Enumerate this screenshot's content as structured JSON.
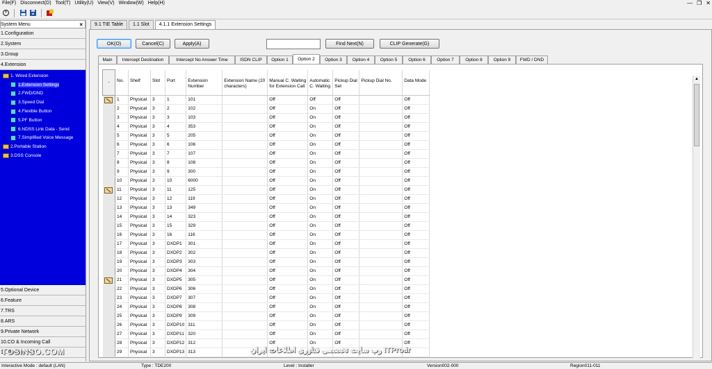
{
  "menubar": {
    "items": [
      "File(F)",
      "Disconnect(D)",
      "Tool(T)",
      "Utility(U)",
      "View(V)",
      "Window(W)",
      "Help(H)"
    ]
  },
  "system_menu": {
    "title": "System Menu",
    "close": "×",
    "top_categories": [
      "1.Configuration",
      "2.System",
      "3.Group",
      "4.Extension"
    ],
    "tree": [
      {
        "label": "1. Wired Extension",
        "level": 0,
        "icon": "folder-icon",
        "selected": false
      },
      {
        "label": "1.Extension Settings",
        "level": 1,
        "icon": "table-icon",
        "selected": true
      },
      {
        "label": "2.FWD/DND",
        "level": 1,
        "icon": "table-icon",
        "selected": false
      },
      {
        "label": "3.Speed Dial",
        "level": 1,
        "icon": "table-icon",
        "selected": false
      },
      {
        "label": "4.Flexible Button",
        "level": 1,
        "icon": "table-icon",
        "selected": false
      },
      {
        "label": "5.PF Button",
        "level": 1,
        "icon": "table-icon",
        "selected": false
      },
      {
        "label": "6.NDSS Link Data - Send",
        "level": 1,
        "icon": "table-icon",
        "selected": false
      },
      {
        "label": "7.Simplified Voice Message",
        "level": 1,
        "icon": "table-icon",
        "selected": false
      },
      {
        "label": "2.Portable Station",
        "level": 0,
        "icon": "folder-icon",
        "selected": false
      },
      {
        "label": "3.DSS Console",
        "level": 0,
        "icon": "folder-icon",
        "selected": false
      }
    ],
    "bottom_categories": [
      "5.Optional Device",
      "6.Feature",
      "7.TRS",
      "8.ARS",
      "9.Private Network",
      "10.CO & Incoming Call",
      "11.Maintenance"
    ]
  },
  "window_tabs": [
    "9.1 TIE Table",
    "1.1 Slot",
    "4.1.1 Extension Settings"
  ],
  "buttons": {
    "ok": "OK(O)",
    "cancel": "Cancel(C)",
    "apply": "Apply(A)",
    "find_next": "Find Next(N)",
    "clip_generate": "CLIP Generate(G)"
  },
  "search": {
    "value": ""
  },
  "subtabs": [
    "Main",
    "Intercept Destination",
    "Intercept No Answer Time",
    "ISDN CLIP",
    "Option 1",
    "Option 2",
    "Option 3",
    "Option 4",
    "Option 5",
    "Option 6",
    "Option 7",
    "Option 8",
    "Option 9",
    "FWD / DND"
  ],
  "active_subtab": "Option 2",
  "table": {
    "select_header": "-",
    "columns": [
      "No.",
      "Shelf",
      "Slot",
      "Port",
      "Extension Number",
      "Extension Name (20 characters)",
      "Manual C. Waiting for Extension Call",
      "Automatic C. Waiting",
      "Pickup Dial Set",
      "Pickup Dial No.",
      "Data Mode"
    ],
    "rows": [
      {
        "mark": true,
        "cells": [
          "1",
          "Physical",
          "3",
          "1",
          "101",
          "",
          "Off",
          "Off",
          "Off",
          "",
          "Off"
        ]
      },
      {
        "mark": false,
        "cells": [
          "2",
          "Physical",
          "3",
          "2",
          "102",
          "",
          "Off",
          "On",
          "Off",
          "",
          "Off"
        ]
      },
      {
        "mark": false,
        "cells": [
          "3",
          "Physical",
          "3",
          "3",
          "103",
          "",
          "Off",
          "On",
          "Off",
          "",
          "Off"
        ]
      },
      {
        "mark": false,
        "cells": [
          "4",
          "Physical",
          "3",
          "4",
          "353",
          "",
          "Off",
          "On",
          "Off",
          "",
          "Off"
        ]
      },
      {
        "mark": false,
        "cells": [
          "5",
          "Physical",
          "3",
          "5",
          "205",
          "",
          "Off",
          "On",
          "Off",
          "",
          "Off"
        ]
      },
      {
        "mark": false,
        "cells": [
          "6",
          "Physical",
          "3",
          "6",
          "106",
          "",
          "Off",
          "On",
          "Off",
          "",
          "Off"
        ]
      },
      {
        "mark": false,
        "cells": [
          "7",
          "Physical",
          "3",
          "7",
          "107",
          "",
          "Off",
          "On",
          "Off",
          "",
          "Off"
        ]
      },
      {
        "mark": false,
        "cells": [
          "8",
          "Physical",
          "3",
          "8",
          "108",
          "",
          "Off",
          "On",
          "Off",
          "",
          "Off"
        ]
      },
      {
        "mark": false,
        "cells": [
          "9",
          "Physical",
          "3",
          "9",
          "300",
          "",
          "Off",
          "On",
          "Off",
          "",
          "Off"
        ]
      },
      {
        "mark": false,
        "cells": [
          "10",
          "Physical",
          "3",
          "10",
          "6000",
          "",
          "Off",
          "On",
          "Off",
          "",
          "Off"
        ]
      },
      {
        "mark": true,
        "cells": [
          "11",
          "Physical",
          "3",
          "11",
          "125",
          "",
          "Off",
          "On",
          "Off",
          "",
          "Off"
        ]
      },
      {
        "mark": false,
        "cells": [
          "12",
          "Physical",
          "3",
          "12",
          "119",
          "",
          "Off",
          "On",
          "Off",
          "",
          "Off"
        ]
      },
      {
        "mark": false,
        "cells": [
          "13",
          "Physical",
          "3",
          "13",
          "349",
          "",
          "Off",
          "On",
          "Off",
          "",
          "Off"
        ]
      },
      {
        "mark": false,
        "cells": [
          "14",
          "Physical",
          "3",
          "14",
          "323",
          "",
          "Off",
          "On",
          "Off",
          "",
          "Off"
        ]
      },
      {
        "mark": false,
        "cells": [
          "15",
          "Physical",
          "3",
          "15",
          "329",
          "",
          "Off",
          "On",
          "Off",
          "",
          "Off"
        ]
      },
      {
        "mark": false,
        "cells": [
          "16",
          "Physical",
          "3",
          "16",
          "116",
          "",
          "Off",
          "On",
          "Off",
          "",
          "Off"
        ]
      },
      {
        "mark": false,
        "cells": [
          "17",
          "Physical",
          "3",
          "DXDP1",
          "301",
          "",
          "Off",
          "On",
          "Off",
          "",
          "Off"
        ]
      },
      {
        "mark": false,
        "cells": [
          "18",
          "Physical",
          "3",
          "DXDP2",
          "302",
          "",
          "Off",
          "On",
          "Off",
          "",
          "Off"
        ]
      },
      {
        "mark": false,
        "cells": [
          "19",
          "Physical",
          "3",
          "DXDP3",
          "303",
          "",
          "Off",
          "On",
          "Off",
          "",
          "Off"
        ]
      },
      {
        "mark": false,
        "cells": [
          "20",
          "Physical",
          "3",
          "DXDP4",
          "304",
          "",
          "Off",
          "On",
          "Off",
          "",
          "Off"
        ]
      },
      {
        "mark": true,
        "cells": [
          "21",
          "Physical",
          "3",
          "DXDP5",
          "305",
          "",
          "Off",
          "On",
          "Off",
          "",
          "Off"
        ]
      },
      {
        "mark": false,
        "cells": [
          "22",
          "Physical",
          "3",
          "DXDP6",
          "306",
          "",
          "Off",
          "On",
          "Off",
          "",
          "Off"
        ]
      },
      {
        "mark": false,
        "cells": [
          "23",
          "Physical",
          "3",
          "DXDP7",
          "307",
          "",
          "Off",
          "On",
          "Off",
          "",
          "Off"
        ]
      },
      {
        "mark": false,
        "cells": [
          "24",
          "Physical",
          "3",
          "DXDP8",
          "308",
          "",
          "Off",
          "On",
          "Off",
          "",
          "Off"
        ]
      },
      {
        "mark": false,
        "cells": [
          "25",
          "Physical",
          "3",
          "DXDP9",
          "309",
          "",
          "Off",
          "On",
          "Off",
          "",
          "Off"
        ]
      },
      {
        "mark": false,
        "cells": [
          "26",
          "Physical",
          "3",
          "DXDP10",
          "311",
          "",
          "Off",
          "On",
          "Off",
          "",
          "Off"
        ]
      },
      {
        "mark": false,
        "cells": [
          "27",
          "Physical",
          "3",
          "DXDP11",
          "320",
          "",
          "Off",
          "On",
          "Off",
          "",
          "Off"
        ]
      },
      {
        "mark": false,
        "cells": [
          "28",
          "Physical",
          "3",
          "DXDP12",
          "312",
          "",
          "Off",
          "On",
          "Off",
          "",
          "Off"
        ]
      },
      {
        "mark": false,
        "cells": [
          "29",
          "Physical",
          "3",
          "DXDP13",
          "313",
          "",
          "Off",
          "On",
          "Off",
          "",
          "Off"
        ]
      }
    ]
  },
  "statusbar": {
    "mode": "Interactive Mode : default (LAN)",
    "type": "Type : TDE200",
    "level": "Level : Installer",
    "version": "Version002-000",
    "region": "Region011-011"
  },
  "watermarks": {
    "left": "TOSINSO.COM",
    "right": "وب سایت تخصصی فناوری اطلاعات ایران ITPro.ir"
  },
  "colors": {
    "tree_bg": "#0000dd",
    "focus_border": "#3399ff"
  }
}
